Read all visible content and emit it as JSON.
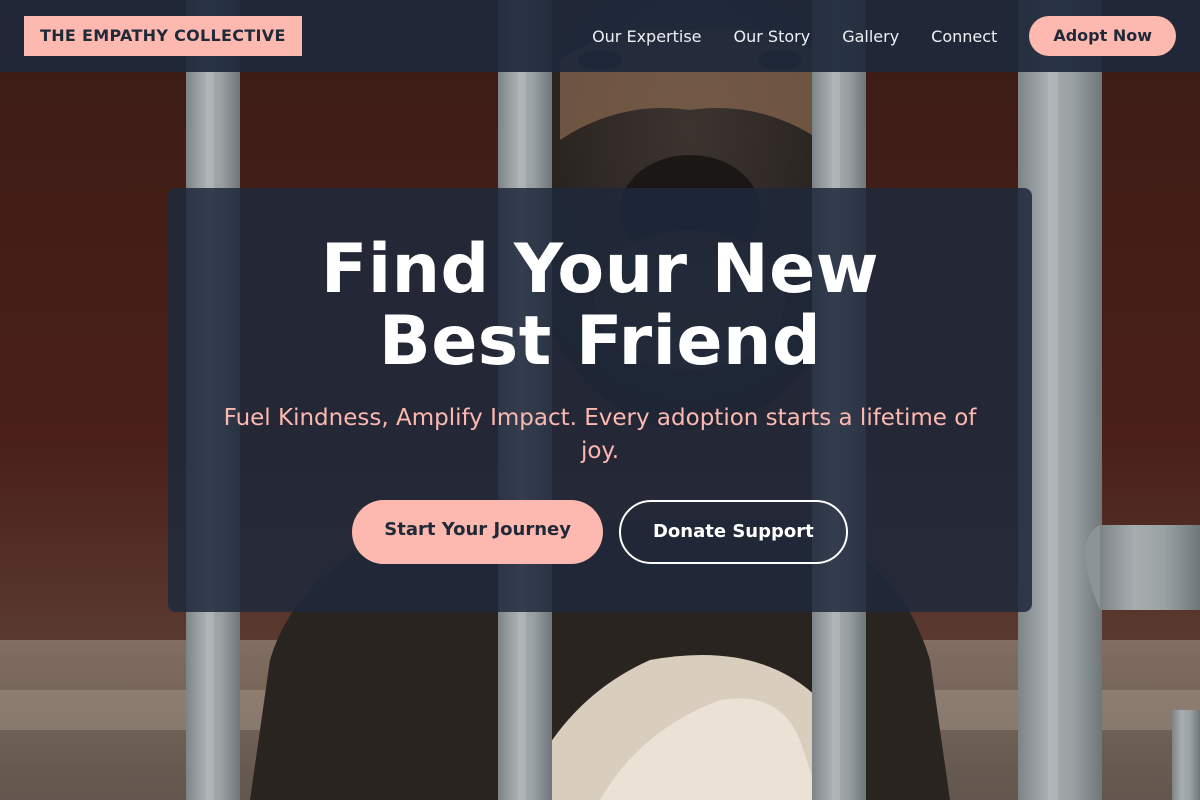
{
  "nav": {
    "brand": "THE EMPATHY COLLECTIVE",
    "links": [
      "Our Expertise",
      "Our Story",
      "Gallery",
      "Connect"
    ],
    "cta": "Adopt Now"
  },
  "hero": {
    "title_line1": "Find Your New",
    "title_line2": "Best Friend",
    "subtitle": "Fuel Kindness, Amplify Impact. Every adoption starts a lifetime of joy.",
    "primary_button": "Start Your Journey",
    "secondary_button": "Donate Support"
  },
  "colors": {
    "accent": "#fdb8b0",
    "navy": "#1e293b",
    "white": "#ffffff"
  },
  "background_image": "dog-behind-metal-bars-photo"
}
